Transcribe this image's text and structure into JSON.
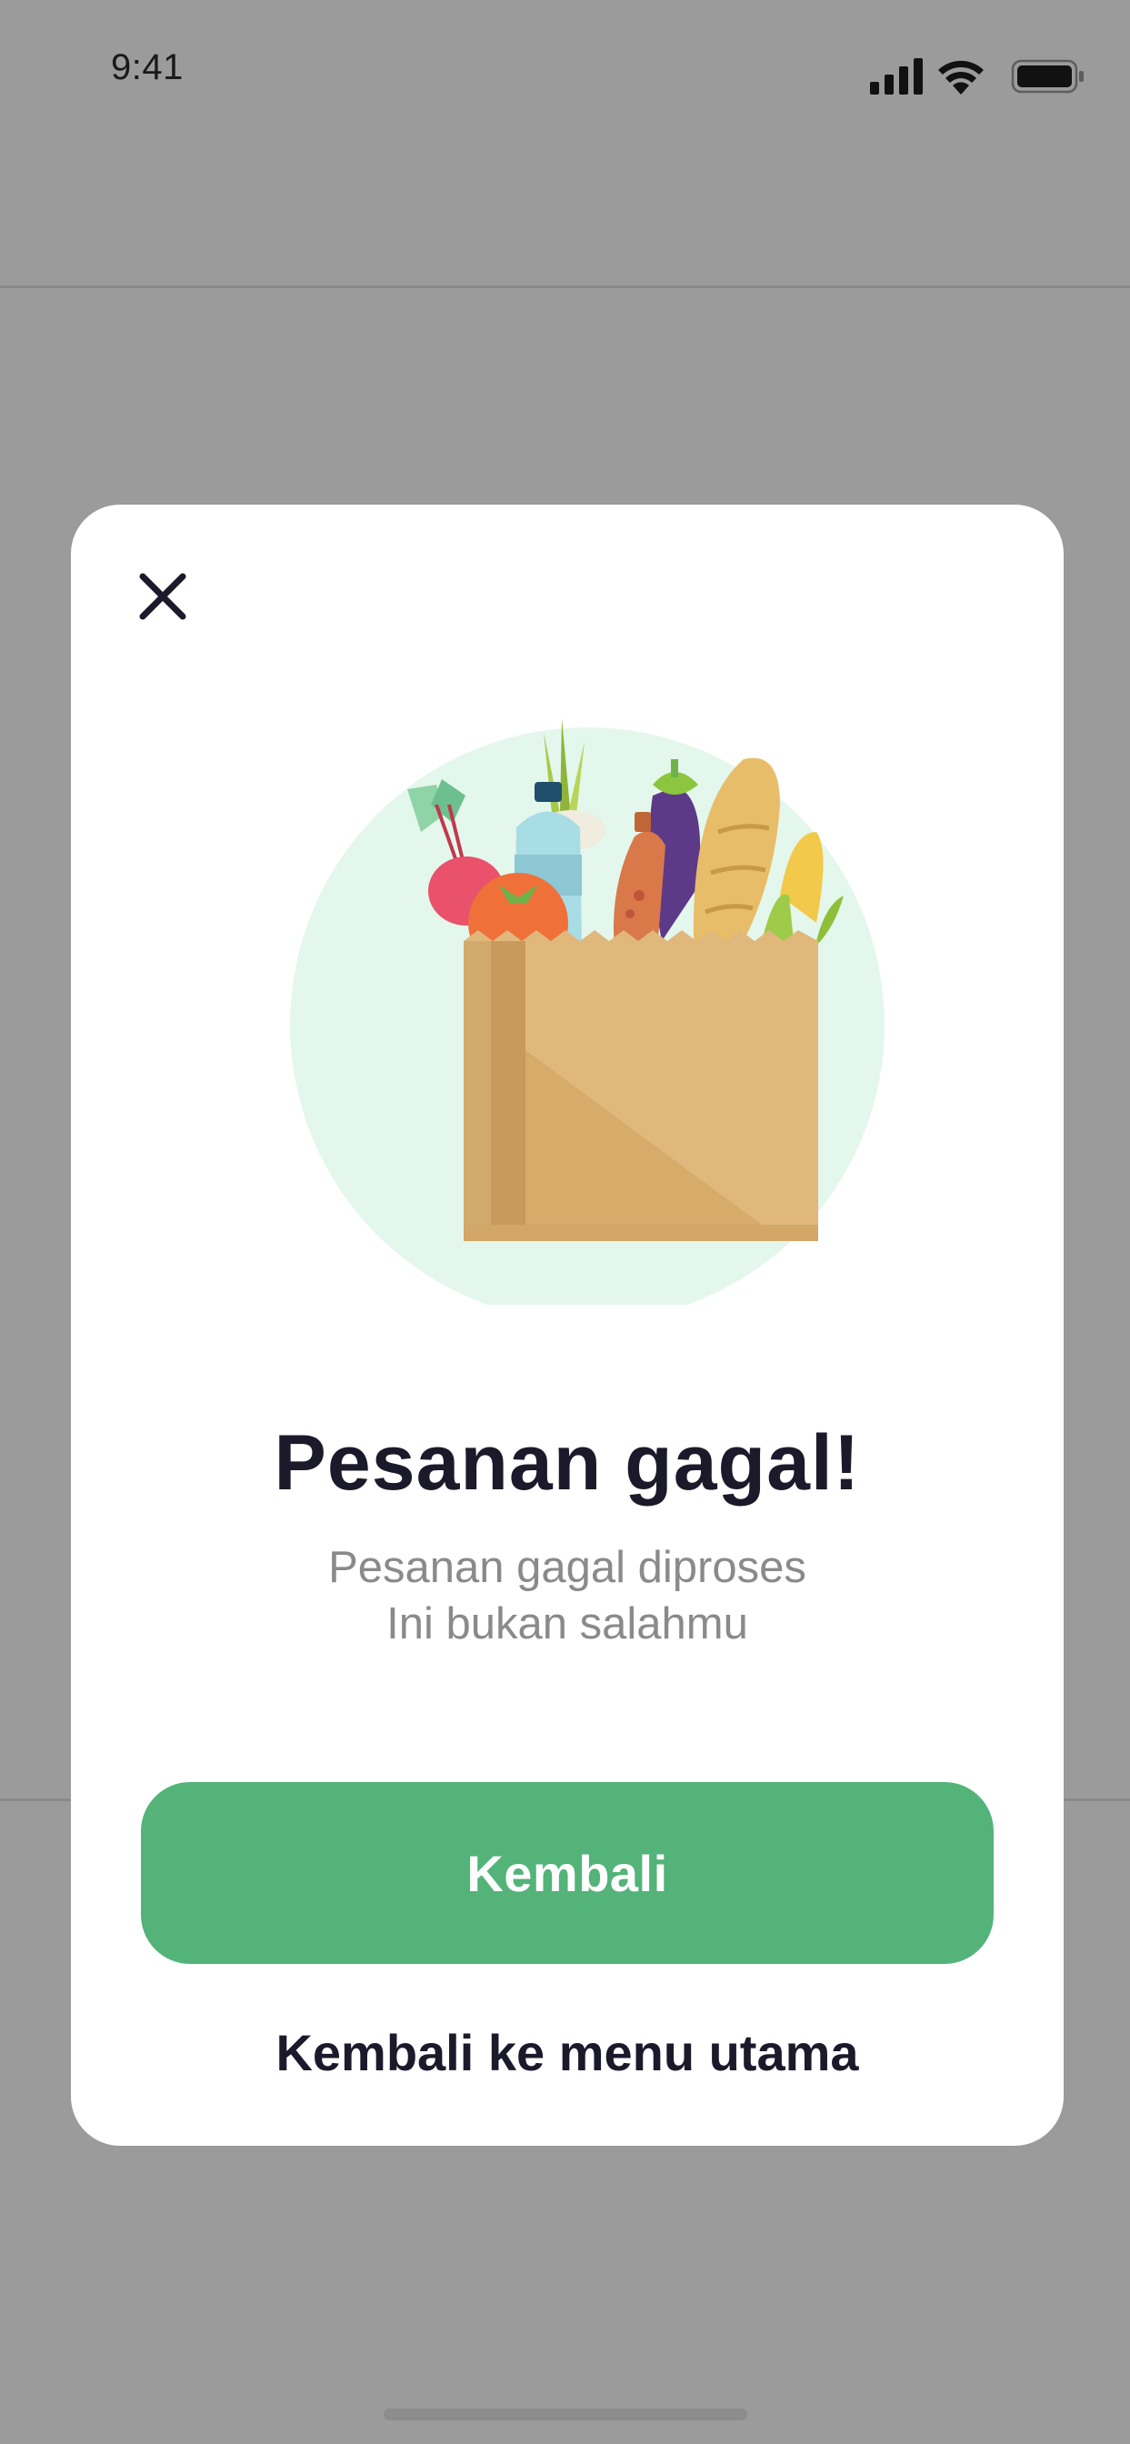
{
  "status_bar": {
    "time": "9:41",
    "icons": [
      "signal-icon",
      "wifi-icon",
      "battery-icon"
    ]
  },
  "modal": {
    "close_icon": "close-icon",
    "illustration": "grocery-bag-illustration",
    "title": "Pesanan gagal!",
    "subtitle_line1": "Pesanan gagal diproses",
    "subtitle_line2": "Ini bukan salahmu",
    "primary_button_label": "Kembali",
    "secondary_link_label": "Kembali ke menu utama"
  },
  "colors": {
    "overlay": "#9b9b9b",
    "primary": "#53b378",
    "title_text": "#1b1a2b",
    "subtitle_text": "#8a8a8a",
    "illustration_circle": "#e4f7ec"
  }
}
